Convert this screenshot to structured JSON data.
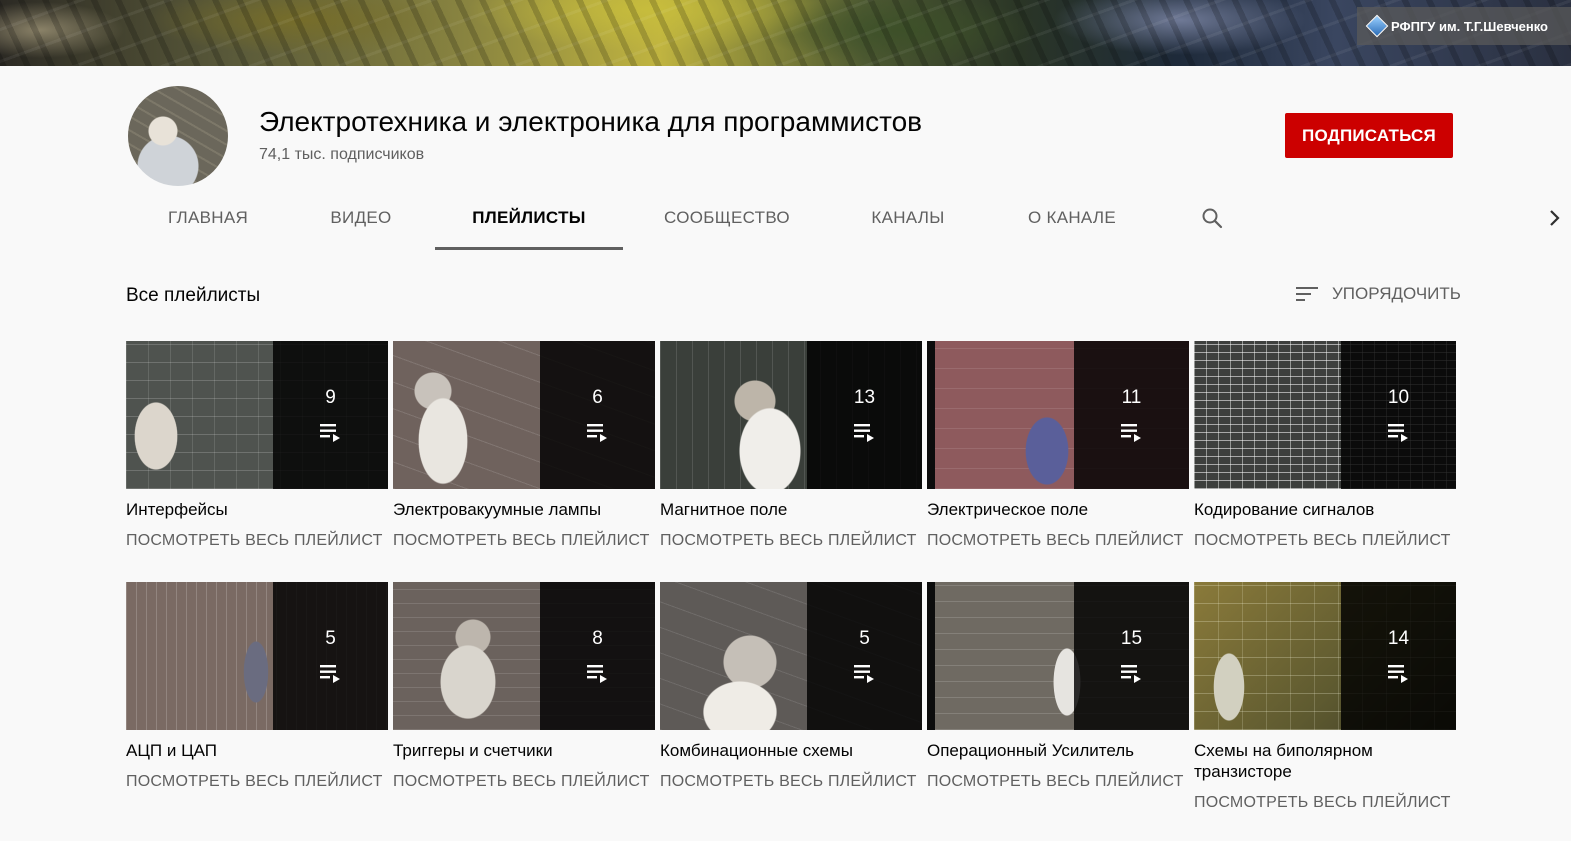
{
  "banner": {
    "tag": "РФПГУ им. Т.Г.Шевченко"
  },
  "channel": {
    "title": "Электротехника и электроника для программистов",
    "subscribers": "74,1 тыс. подписчиков",
    "subscribe_label": "ПОДПИСАТЬСЯ"
  },
  "tabs": [
    {
      "label": "ГЛАВНАЯ"
    },
    {
      "label": "ВИДЕО"
    },
    {
      "label": "ПЛЕЙЛИСТЫ"
    },
    {
      "label": "СООБЩЕСТВО"
    },
    {
      "label": "КАНАЛЫ"
    },
    {
      "label": "О КАНАЛЕ"
    }
  ],
  "active_tab": "ПЛЕЙЛИСТЫ",
  "section": {
    "title": "Все плейлисты",
    "sort_label": "УПОРЯДОЧИТЬ"
  },
  "playlists": [
    {
      "title": "Интерфейсы",
      "count": "9",
      "link": "ПОСМОТРЕТЬ ВЕСЬ ПЛЕЙЛИСТ"
    },
    {
      "title": "Электровакуумные лампы",
      "count": "6",
      "link": "ПОСМОТРЕТЬ ВЕСЬ ПЛЕЙЛИСТ"
    },
    {
      "title": "Магнитное поле",
      "count": "13",
      "link": "ПОСМОТРЕТЬ ВЕСЬ ПЛЕЙЛИСТ"
    },
    {
      "title": "Электрическое поле",
      "count": "11",
      "link": "ПОСМОТРЕТЬ ВЕСЬ ПЛЕЙЛИСТ"
    },
    {
      "title": "Кодирование сигналов",
      "count": "10",
      "link": "ПОСМОТРЕТЬ ВЕСЬ ПЛЕЙЛИСТ"
    },
    {
      "title": "АЦП и ЦАП",
      "count": "5",
      "link": "ПОСМОТРЕТЬ ВЕСЬ ПЛЕЙЛИСТ"
    },
    {
      "title": "Триггеры и счетчики",
      "count": "8",
      "link": "ПОСМОТРЕТЬ ВЕСЬ ПЛЕЙЛИСТ"
    },
    {
      "title": "Комбинационные схемы",
      "count": "5",
      "link": "ПОСМОТРЕТЬ ВЕСЬ ПЛЕЙЛИСТ"
    },
    {
      "title": "Операционный Усилитель",
      "count": "15",
      "link": "ПОСМОТРЕТЬ ВЕСЬ ПЛЕЙЛИСТ"
    },
    {
      "title": "Схемы на биполярном транзисторе",
      "count": "14",
      "link": "ПОСМОТРЕТЬ ВЕСЬ ПЛЕЙЛИСТ"
    }
  ],
  "colors": {
    "subscribe": "#cc0000",
    "text_primary": "#030303",
    "text_secondary": "#606060",
    "background": "#f9f9f9"
  },
  "icons": {
    "search": "search-icon",
    "next": "chevron-right-icon",
    "sort": "sort-icon",
    "playlist": "playlist-play-icon"
  }
}
